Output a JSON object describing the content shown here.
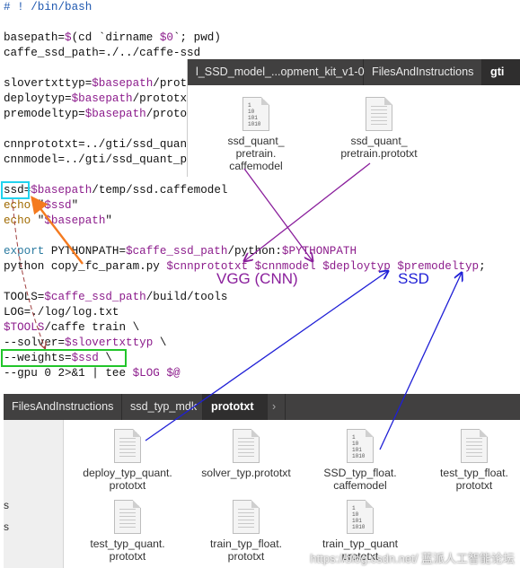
{
  "script": {
    "shebang": "# ! /bin/bash",
    "l_basepath": [
      "basepath=",
      "$(cd `dirname ",
      "$0",
      "`; pwd)"
    ],
    "l_caffe": "caffe_ssd_path=./../caffe-ssd",
    "l_slover": [
      "slovertxttyp=",
      "$basepath",
      "/prototxt/solver_typ.prototxt"
    ],
    "l_deploy": [
      "deploytyp=",
      "$basepath",
      "/prototxt/deploy_typ_quant.prototxt"
    ],
    "l_premodel": [
      "premodeltyp=",
      "$basepath",
      "/prototxt/SSD_typ_float.caffemodel"
    ],
    "l_cnnproto": "cnnprototxt=../gti/ssd_quant_pretrain.prototxt",
    "l_cnnmodel": "cnnmodel=../gti/ssd_quant_pretrain.caffemodel",
    "l_ssd": [
      "ssd",
      "=",
      "$basepath",
      "/temp/ssd.caffemodel"
    ],
    "l_echo1": [
      "echo",
      " \"",
      "$ssd",
      "\""
    ],
    "l_echo2": [
      "echo",
      " \"",
      "$basepath",
      "\""
    ],
    "l_export": [
      "export",
      " PYTHONPATH=",
      "$caffe_ssd_path",
      "/python:",
      "$PYTHONPATH"
    ],
    "l_python": [
      "python copy_fc_param.py ",
      "$cnnprototxt",
      " ",
      "$cnnmodel",
      " ",
      "$deploytyp",
      " ",
      "$premodeltyp",
      ";"
    ],
    "l_tools": [
      "TOOLS=",
      "$caffe_ssd_path",
      "/build/tools"
    ],
    "l_log": "LOG=./log/log.txt",
    "l_train": [
      "$TOOLS",
      "/caffe train \\"
    ],
    "l_solver": [
      "--solver=",
      "$slovertxttyp",
      " \\"
    ],
    "l_weights": [
      "--weights=",
      "$ssd",
      " \\"
    ],
    "l_gpu": [
      "--gpu 0 2>&1 | tee ",
      "$LOG",
      " ",
      "$@"
    ]
  },
  "top_window": {
    "crumbs": [
      "l_SSD_model_...opment_kit_v1-0",
      "FilesAndInstructions",
      "gti"
    ],
    "files": [
      {
        "name": "ssd_quant_\npretrain.\ncaffemodel",
        "type": "binary",
        "bin_text": "1\n10\n101\n1010"
      },
      {
        "name": "ssd_quant_\npretrain.prototxt",
        "type": "text"
      }
    ]
  },
  "bottom_window": {
    "crumbs": [
      "FilesAndInstructions",
      "ssd_typ_mdk",
      "prototxt"
    ],
    "arrow": "›",
    "side_items": [
      "s",
      "s"
    ],
    "files": [
      {
        "name": "deploy_typ_quant.\nprototxt",
        "type": "text"
      },
      {
        "name": "solver_typ.prototxt",
        "type": "text"
      },
      {
        "name": "SSD_typ_float.\ncaffemodel",
        "type": "binary",
        "bin_text": "1\n10\n101\n1010"
      },
      {
        "name": "test_typ_float.\nprototxt",
        "type": "text"
      },
      {
        "name": "test_typ_quant.\nprototxt",
        "type": "text"
      },
      {
        "name": "train_typ_float.\nprototxt",
        "type": "text"
      },
      {
        "name": "train_typ_quant\nprototxt",
        "type": "binary",
        "bin_text": "1\n10\n101\n1010"
      }
    ]
  },
  "annotations": {
    "vgg_label": "VGG (CNN)",
    "ssd_label": "SSD",
    "vgg_color": "#8a1f9c",
    "ssd_color": "#1f1fd6",
    "orange": "#f47a1f",
    "cyan": "#22d3ee",
    "green": "#22c52a"
  },
  "watermark": "https://blog.csdn.net/  蓝派人工智能论坛"
}
